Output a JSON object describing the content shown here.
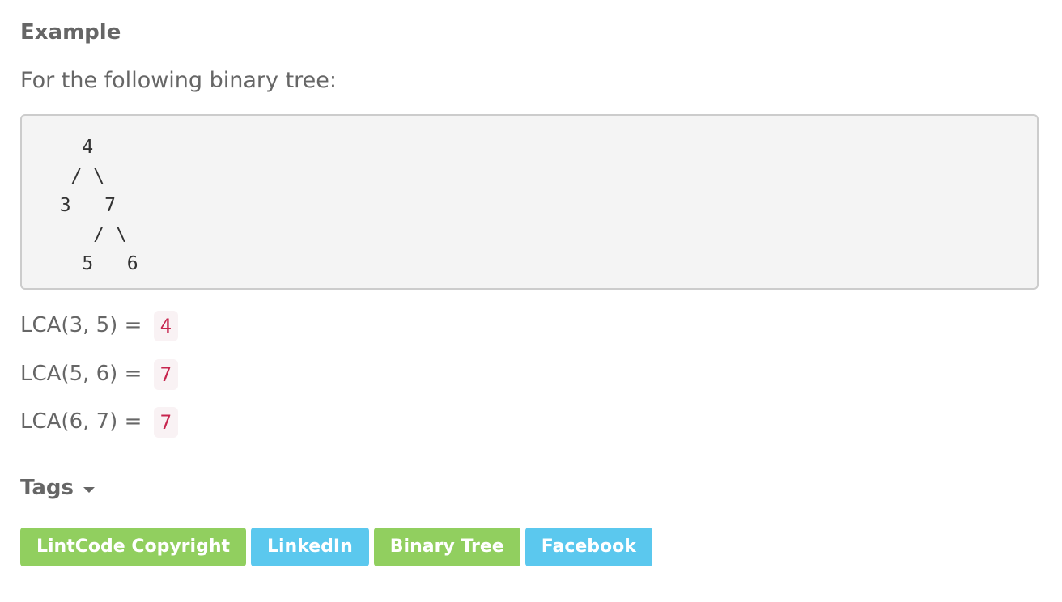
{
  "example": {
    "heading": "Example",
    "intro": "For the following binary tree:",
    "tree_text": "    4\n   / \\\n  3   7\n     / \\\n    5   6"
  },
  "lca": [
    {
      "expression": "LCA(3, 5) =",
      "result": "4"
    },
    {
      "expression": "LCA(5, 6) =",
      "result": "7"
    },
    {
      "expression": "LCA(6, 7) =",
      "result": "7"
    }
  ],
  "tags": {
    "label": "Tags",
    "items": [
      {
        "label": "LintCode Copyright",
        "color": "#91cf5f"
      },
      {
        "label": "LinkedIn",
        "color": "#5bc8ee"
      },
      {
        "label": "Binary Tree",
        "color": "#91cf5f"
      },
      {
        "label": "Facebook",
        "color": "#5bc8ee"
      }
    ]
  },
  "colors": {
    "text": "#666666",
    "code_bg": "#f4f4f4",
    "code_border": "#cccccc",
    "inline_code": "#c7254e",
    "inline_code_bg": "#f9f2f4",
    "tag_green": "#91cf5f",
    "tag_blue": "#5bc8ee"
  }
}
